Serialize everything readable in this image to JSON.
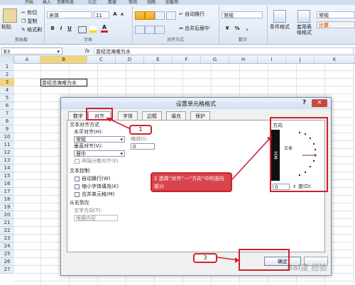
{
  "ribbon": {
    "tabs": [
      "开始",
      "插入",
      "页面布局",
      "公式",
      "数据",
      "审阅",
      "视图",
      "加载项"
    ],
    "clipboard": {
      "paste": "粘贴",
      "cut": "剪切",
      "copy": "复制",
      "format_painter": "格式刷",
      "group": "剪贴板"
    },
    "font": {
      "name": "宋体",
      "size": "11",
      "group": "字体",
      "bold": "B",
      "italic": "I",
      "underline": "U",
      "grow": "A",
      "shrink": "A"
    },
    "alignment": {
      "wrap": "自动换行",
      "merge": "合并后居中",
      "group": "对齐方式"
    },
    "number": {
      "format": "常规",
      "percent": "%",
      "comma": ",",
      "group": "数字"
    },
    "styles": {
      "conditional": "条件格式",
      "table": "套用表格格式",
      "normal": "常规",
      "calc": "计算"
    }
  },
  "formula_bar": {
    "name_box": "B3",
    "fx": "fx",
    "value": "曾经沧海难为水"
  },
  "sheet": {
    "columns": [
      "A",
      "B",
      "C",
      "D",
      "E",
      "F",
      "G",
      "H",
      "I",
      "J",
      "K"
    ],
    "rows": [
      "1",
      "2",
      "3",
      "4",
      "5",
      "6",
      "7",
      "8",
      "9",
      "10",
      "11",
      "12",
      "13",
      "14",
      "15",
      "16",
      "17",
      "18",
      "19",
      "20",
      "21",
      "22",
      "23",
      "24",
      "25",
      "26",
      "27"
    ],
    "cell_b3": "曾经沧海难为水"
  },
  "dialog": {
    "title": "设置单元格格式",
    "help": "?",
    "close": "×",
    "tabs": [
      "数字",
      "对齐",
      "字体",
      "边框",
      "填充",
      "保护"
    ],
    "text_align_section": "文本对齐方式",
    "h_align_label": "水平对齐(H):",
    "h_align_value": "常规",
    "indent_label": "缩进(I):",
    "indent_value": "0",
    "v_align_label": "垂直对齐(V):",
    "v_align_value": "居中",
    "justify_distributed": "两端分散对齐(E)",
    "text_control_section": "文本控制",
    "wrap_text": "自动换行(W)",
    "shrink_to_fit": "缩小字体填充(K)",
    "merge_cells": "合并单元格(M)",
    "rtl_section": "从右到左",
    "text_direction_label": "文字方向(T):",
    "text_direction_value": "根据内容",
    "orientation_title": "方向",
    "vertical_text": "文本",
    "horizontal_text": "文本",
    "degree_value": "0",
    "degree_label": "度(D)",
    "ok_button": "确定"
  },
  "annotations": {
    "step1": "1",
    "step2": "2 选择“对齐”---“方向”中的竖向部分",
    "step3": "3"
  },
  "watermark": "Bai度 经验",
  "colors": {
    "accent": "#d0202c",
    "ribbon": "#dbe6f4",
    "orientation_bar": "#111111"
  }
}
